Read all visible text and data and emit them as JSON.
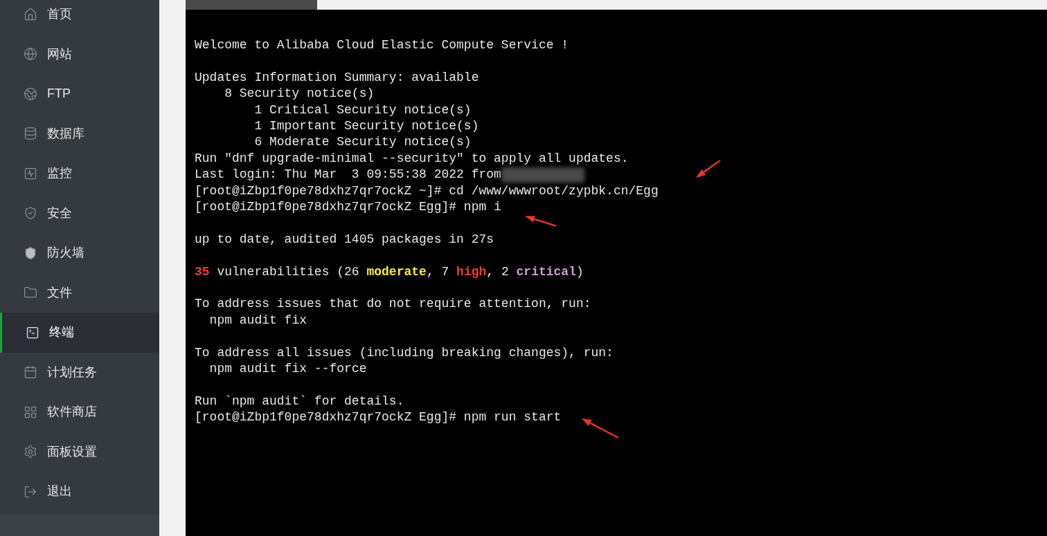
{
  "sidebar": {
    "items": [
      {
        "label": "首页",
        "selected": false
      },
      {
        "label": "网站",
        "selected": false
      },
      {
        "label": "FTP",
        "selected": false
      },
      {
        "label": "数据库",
        "selected": false
      },
      {
        "label": "监控",
        "selected": false
      },
      {
        "label": "安全",
        "selected": false
      },
      {
        "label": "防火墙",
        "selected": false
      },
      {
        "label": "文件",
        "selected": false
      },
      {
        "label": "终端",
        "selected": true
      },
      {
        "label": "计划任务",
        "selected": false
      },
      {
        "label": "软件商店",
        "selected": false
      },
      {
        "label": "面板设置",
        "selected": false
      },
      {
        "label": "退出",
        "selected": false
      }
    ]
  },
  "terminal": {
    "blocks": [
      [
        {
          "segments": [
            {
              "text": "Welcome to Alibaba Cloud Elastic Compute Service !"
            }
          ]
        }
      ],
      [
        {
          "segments": [
            {
              "text": "Updates Information Summary: available"
            }
          ]
        },
        {
          "segments": [
            {
              "text": "    8 Security notice(s)"
            }
          ]
        },
        {
          "segments": [
            {
              "text": "        1 Critical Security notice(s)"
            }
          ]
        },
        {
          "segments": [
            {
              "text": "        1 Important Security notice(s)"
            }
          ]
        },
        {
          "segments": [
            {
              "text": "        6 Moderate Security notice(s)"
            }
          ]
        },
        {
          "segments": [
            {
              "text": "Run \"dnf upgrade-minimal --security\" to apply all updates."
            }
          ]
        },
        {
          "segments": [
            {
              "text": "Last login: Thu Mar  3 09:55:38 2022 from"
            }
          ],
          "redacted": true
        },
        {
          "segments": [
            {
              "text": "[root@iZbp1f0pe78dxhz7qr7ockZ ~]# cd /www/wwwroot/zypbk.cn/Egg"
            }
          ]
        },
        {
          "segments": [
            {
              "text": "[root@iZbp1f0pe78dxhz7qr7ockZ Egg]# npm i"
            }
          ]
        }
      ],
      [
        {
          "segments": [
            {
              "text": "up to date, audited 1405 packages in 27s"
            }
          ]
        }
      ],
      [
        {
          "segments": [
            {
              "text": "35",
              "color": "#ef3b3b",
              "bold": true
            },
            {
              "text": " vulnerabilities (26 "
            },
            {
              "text": "moderate",
              "color": "#ffee33",
              "bold": true
            },
            {
              "text": ", 7 "
            },
            {
              "text": "high",
              "color": "#ef3b3b",
              "bold": true
            },
            {
              "text": ", 2 "
            },
            {
              "text": "critical",
              "color": "#c8a0cf",
              "bold": true
            },
            {
              "text": ")"
            }
          ]
        }
      ],
      [
        {
          "segments": [
            {
              "text": "To address issues that do not require attention, run:"
            }
          ]
        },
        {
          "segments": [
            {
              "text": "  npm audit fix"
            }
          ]
        }
      ],
      [
        {
          "segments": [
            {
              "text": "To address all issues (including breaking changes), run:"
            }
          ]
        },
        {
          "segments": [
            {
              "text": "  npm audit fix --force"
            }
          ]
        }
      ],
      [
        {
          "segments": [
            {
              "text": "Run `npm audit` for details."
            }
          ]
        },
        {
          "segments": [
            {
              "text": "[root@iZbp1f0pe78dxhz7qr7ockZ Egg]# npm run start"
            }
          ]
        }
      ]
    ]
  }
}
